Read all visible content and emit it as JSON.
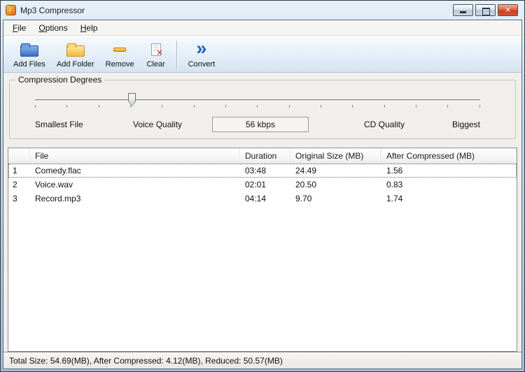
{
  "window": {
    "title": "Mp3 Compressor"
  },
  "colors": {
    "titlebar_gradient_top": "#e7f0f9",
    "titlebar_gradient_bottom": "#a6bdd6",
    "close_button_red": "#c8431c",
    "convert_chevron_blue": "#1d5ec4",
    "add_files_folder_blue": "#3a6fc2",
    "add_folder_yellow": "#f2b93e",
    "client_background": "#f1efec"
  },
  "menu": {
    "items": [
      {
        "label": "File"
      },
      {
        "label": "Options"
      },
      {
        "label": "Help"
      }
    ]
  },
  "toolbar": {
    "buttons": [
      {
        "label": "Add Files",
        "icon": "add-files-folder-icon"
      },
      {
        "label": "Add Folder",
        "icon": "add-folder-icon"
      },
      {
        "label": "Remove",
        "icon": "remove-minus-icon"
      },
      {
        "label": "Clear",
        "icon": "clear-document-icon"
      },
      {
        "label": "Convert",
        "icon": "convert-chevrons-icon"
      }
    ]
  },
  "compression": {
    "group_label": "Compression Degrees",
    "scale_labels": {
      "smallest": "Smallest File",
      "voice": "Voice Quality",
      "cd": "CD Quality",
      "biggest": "Biggest"
    },
    "current_value": "56 kbps",
    "slider_position_percent": 21.7
  },
  "table": {
    "columns": {
      "num": "",
      "file": "File",
      "duration": "Duration",
      "original": "Original Size (MB)",
      "compressed": "After Compressed (MB)"
    },
    "rows": [
      {
        "num": "1",
        "file": "Comedy.flac",
        "duration": "03:48",
        "original": "24.49",
        "compressed": "1.56",
        "selected": true
      },
      {
        "num": "2",
        "file": "Voice.wav",
        "duration": "02:01",
        "original": "20.50",
        "compressed": "0.83",
        "selected": false
      },
      {
        "num": "3",
        "file": "Record.mp3",
        "duration": "04:14",
        "original": "9.70",
        "compressed": "1.74",
        "selected": false
      }
    ]
  },
  "status_bar": {
    "text": "Total Size: 54.69(MB), After Compressed: 4.12(MB), Reduced: 50.57(MB)"
  }
}
